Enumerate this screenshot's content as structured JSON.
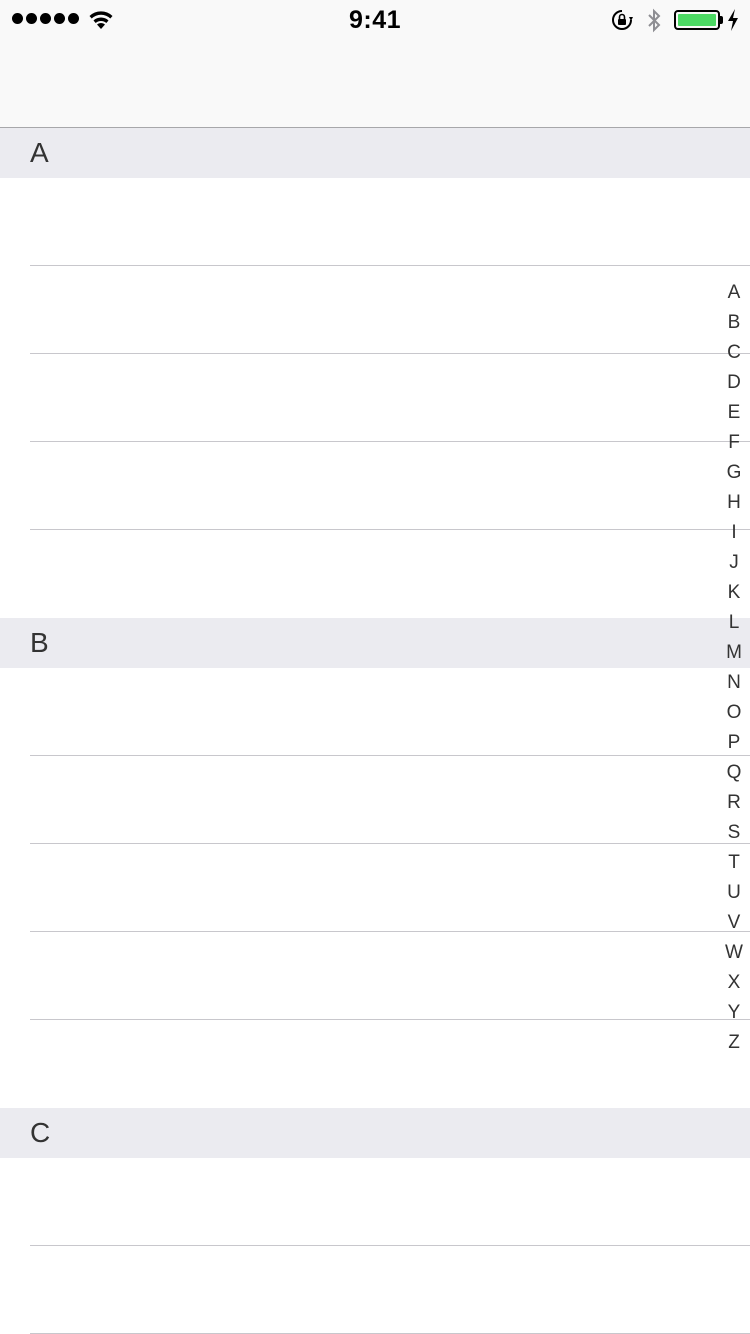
{
  "status_bar": {
    "time": "9:41",
    "signal_bars": 5,
    "battery_level": 1.0,
    "battery_color": "#4cd964",
    "icons": [
      "signal-dots-icon",
      "wifi-icon",
      "rotation-lock-icon",
      "bluetooth-icon",
      "battery-icon",
      "charging-bolt-icon"
    ]
  },
  "sections": [
    {
      "title": "A",
      "rows": 5
    },
    {
      "title": "B",
      "rows": 5
    },
    {
      "title": "C",
      "rows": 2
    }
  ],
  "index": [
    "A",
    "B",
    "C",
    "D",
    "E",
    "F",
    "G",
    "H",
    "I",
    "J",
    "K",
    "L",
    "M",
    "N",
    "O",
    "P",
    "Q",
    "R",
    "S",
    "T",
    "U",
    "V",
    "W",
    "X",
    "Y",
    "Z"
  ],
  "colors": {
    "section_header_bg": "#ebebf0",
    "separator": "#c8c7cc",
    "nav_bg": "#f9f9f9"
  }
}
